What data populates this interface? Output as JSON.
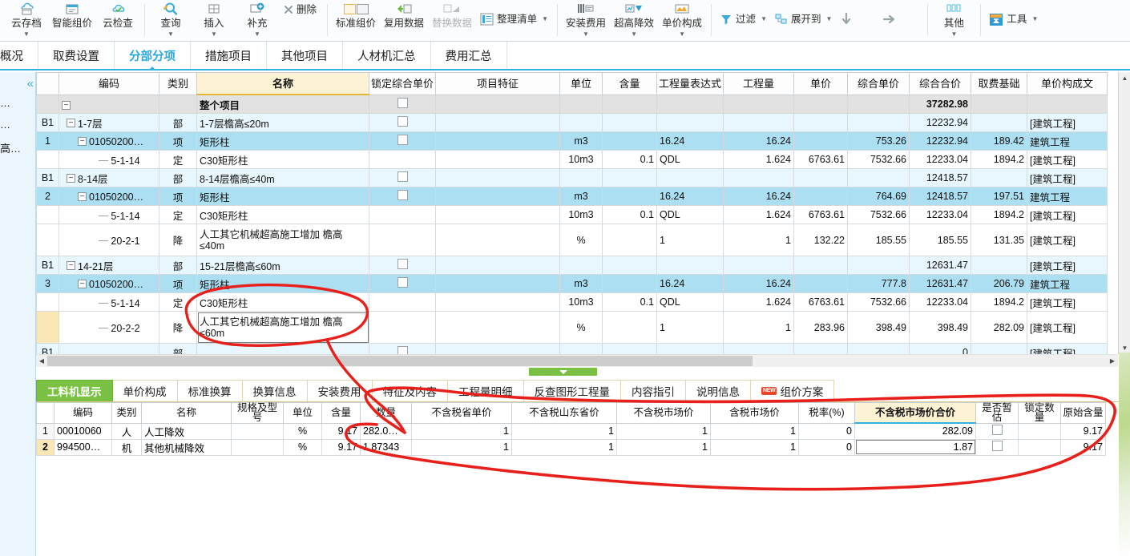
{
  "ribbon": {
    "groups": [
      {
        "name": "cloud",
        "items": [
          {
            "label": "云存档",
            "icon": "cloud-archive-icon",
            "caret": true
          },
          {
            "label": "智能组价",
            "icon": "smart-price-icon",
            "caret": false
          },
          {
            "label": "云检查",
            "icon": "cloud-check-icon",
            "caret": false
          }
        ]
      },
      {
        "name": "edit",
        "items": [
          {
            "label": "查询",
            "icon": "search-icon",
            "caret": true
          },
          {
            "label": "插入",
            "icon": "insert-icon",
            "caret": true
          },
          {
            "label": "补充",
            "icon": "supplement-icon",
            "caret": true
          },
          {
            "label": "删除",
            "icon": "delete-icon",
            "caret": false
          }
        ]
      },
      {
        "name": "data",
        "items": [
          {
            "label": "标准组价",
            "icon": "standard-price-icon",
            "caret": false
          },
          {
            "label": "复用数据",
            "icon": "reuse-data-icon",
            "caret": false
          },
          {
            "label": "替换数据",
            "icon": "replace-data-icon",
            "caret": false,
            "disabled": true
          },
          {
            "label": "整理清单",
            "icon": "organize-list-icon",
            "caret": true
          }
        ]
      },
      {
        "name": "cost",
        "items": [
          {
            "label": "安装费用",
            "icon": "install-cost-icon",
            "caret": true
          },
          {
            "label": "超高降效",
            "icon": "height-efficiency-icon",
            "caret": true
          },
          {
            "label": "单价构成",
            "icon": "unit-price-composition-icon",
            "caret": true
          }
        ]
      },
      {
        "name": "view",
        "items": [
          {
            "label": "过滤",
            "icon": "filter-icon",
            "caret": true
          },
          {
            "label": "展开到",
            "icon": "expand-to-icon",
            "caret": true
          },
          {
            "label": "",
            "icon": "arrow-down-icon",
            "caret": false
          },
          {
            "label": "",
            "icon": "arrow-right-icon",
            "caret": false
          }
        ]
      },
      {
        "name": "other",
        "items": [
          {
            "label": "其他",
            "icon": "other-icon",
            "caret": true
          }
        ]
      },
      {
        "name": "tools",
        "items": [
          {
            "label": "工具",
            "icon": "tools-icon",
            "caret": true
          }
        ]
      }
    ]
  },
  "module_tabs": [
    {
      "label": "概况",
      "active": false
    },
    {
      "label": "取费设置",
      "active": false
    },
    {
      "label": "分部分项",
      "active": true
    },
    {
      "label": "措施项目",
      "active": false
    },
    {
      "label": "其他项目",
      "active": false
    },
    {
      "label": "人材机汇总",
      "active": false
    },
    {
      "label": "费用汇总",
      "active": false
    }
  ],
  "rail": {
    "collapse_icon": "chevron-double-left-icon",
    "items": [
      "…",
      "…",
      "高…"
    ]
  },
  "main_grid": {
    "columns": [
      "",
      "编码",
      "类别",
      "名称",
      "锁定综合单价",
      "项目特征",
      "单位",
      "含量",
      "工程量表达式",
      "工程量",
      "单价",
      "综合单价",
      "综合合价",
      "取费基础",
      "单价构成文"
    ],
    "rows": [
      {
        "style": "total",
        "rowno": "",
        "tree": "box",
        "indent": 0,
        "code": "",
        "cat": "",
        "name": "整个项目",
        "lock": true,
        "feature": "",
        "unit": "",
        "content": "",
        "expr": "",
        "qty": "",
        "price": "",
        "comp_price": "",
        "total": "37282.98",
        "base": "",
        "comp_doc": ""
      },
      {
        "style": "part",
        "rowno": "B1",
        "tree": "box",
        "indent": 1,
        "code": "1-7层",
        "cat": "部",
        "name": "1-7层檐高≤20m",
        "lock": true,
        "feature": "",
        "unit": "",
        "content": "",
        "expr": "",
        "qty": "",
        "price": "",
        "comp_price": "",
        "total": "12232.94",
        "base": "",
        "comp_doc": "[建筑工程]"
      },
      {
        "style": "item",
        "rowno": "1",
        "tree": "box",
        "indent": 2,
        "code": "01050200…",
        "cat": "项",
        "name": "矩形柱",
        "lock": true,
        "feature": "",
        "unit": "m3",
        "content": "",
        "expr": "16.24",
        "qty": "16.24",
        "price": "",
        "comp_price": "753.26",
        "total": "12232.94",
        "base": "189.42",
        "comp_doc": "建筑工程"
      },
      {
        "style": "norm",
        "rowno": "",
        "tree": "leaf",
        "indent": 3,
        "code": "5-1-14",
        "cat": "定",
        "name": "C30矩形柱",
        "lock": false,
        "feature": "",
        "unit": "10m3",
        "content": "0.1",
        "expr": "QDL",
        "qty": "1.624",
        "price": "6763.61",
        "comp_price": "7532.66",
        "total": "12233.04",
        "base": "1894.2",
        "comp_doc": "[建筑工程]"
      },
      {
        "style": "part",
        "rowno": "B1",
        "tree": "box",
        "indent": 1,
        "code": "8-14层",
        "cat": "部",
        "name": "8-14层檐高≤40m",
        "lock": true,
        "feature": "",
        "unit": "",
        "content": "",
        "expr": "",
        "qty": "",
        "price": "",
        "comp_price": "",
        "total": "12418.57",
        "base": "",
        "comp_doc": "[建筑工程]"
      },
      {
        "style": "item",
        "rowno": "2",
        "tree": "box",
        "indent": 2,
        "code": "01050200…",
        "cat": "项",
        "name": "矩形柱",
        "lock": true,
        "feature": "",
        "unit": "m3",
        "content": "",
        "expr": "16.24",
        "qty": "16.24",
        "price": "",
        "comp_price": "764.69",
        "total": "12418.57",
        "base": "197.51",
        "comp_doc": "建筑工程"
      },
      {
        "style": "norm",
        "rowno": "",
        "tree": "leaf",
        "indent": 3,
        "code": "5-1-14",
        "cat": "定",
        "name": "C30矩形柱",
        "lock": false,
        "feature": "",
        "unit": "10m3",
        "content": "0.1",
        "expr": "QDL",
        "qty": "1.624",
        "price": "6763.61",
        "comp_price": "7532.66",
        "total": "12233.04",
        "base": "1894.2",
        "comp_doc": "[建筑工程]"
      },
      {
        "style": "norm",
        "tall": true,
        "rowno": "",
        "tree": "leaf",
        "indent": 3,
        "code": "20-2-1",
        "cat": "降",
        "name": "人工其它机械超高施工增加 檐高≤40m",
        "lock": false,
        "feature": "",
        "unit": "%",
        "content": "",
        "expr": "1",
        "qty": "1",
        "price": "132.22",
        "comp_price": "185.55",
        "total": "185.55",
        "base": "131.35",
        "comp_doc": "[建筑工程]"
      },
      {
        "style": "part",
        "rowno": "B1",
        "tree": "box",
        "indent": 1,
        "code": "14-21层",
        "cat": "部",
        "name": "15-21层檐高≤60m",
        "lock": true,
        "feature": "",
        "unit": "",
        "content": "",
        "expr": "",
        "qty": "",
        "price": "",
        "comp_price": "",
        "total": "12631.47",
        "base": "",
        "comp_doc": "[建筑工程]"
      },
      {
        "style": "item",
        "rowno": "3",
        "tree": "box",
        "indent": 2,
        "code": "01050200…",
        "cat": "项",
        "name": "矩形柱",
        "lock": true,
        "feature": "",
        "unit": "m3",
        "content": "",
        "expr": "16.24",
        "qty": "16.24",
        "price": "",
        "comp_price": "777.8",
        "total": "12631.47",
        "base": "206.79",
        "comp_doc": "建筑工程"
      },
      {
        "style": "norm",
        "rowno": "",
        "tree": "leaf",
        "indent": 3,
        "code": "5-1-14",
        "cat": "定",
        "name": "C30矩形柱",
        "lock": false,
        "feature": "",
        "unit": "10m3",
        "content": "0.1",
        "expr": "QDL",
        "qty": "1.624",
        "price": "6763.61",
        "comp_price": "7532.66",
        "total": "12233.04",
        "base": "1894.2",
        "comp_doc": "[建筑工程]"
      },
      {
        "style": "norm",
        "tall": true,
        "current": true,
        "selected_name": true,
        "rowno": "",
        "tree": "leaf",
        "indent": 3,
        "code": "20-2-2",
        "cat": "降",
        "name": "人工其它机械超高施工增加 檐高≤60m",
        "lock": false,
        "feature": "",
        "unit": "%",
        "content": "",
        "expr": "1",
        "qty": "1",
        "price": "283.96",
        "comp_price": "398.49",
        "total": "398.49",
        "base": "282.09",
        "comp_doc": "[建筑工程]"
      },
      {
        "style": "part",
        "rowno": "B1",
        "tree": "none",
        "indent": 1,
        "code": "",
        "cat": "部",
        "name": "",
        "lock": true,
        "feature": "",
        "unit": "",
        "content": "",
        "expr": "",
        "qty": "",
        "price": "",
        "comp_price": "",
        "total": "0",
        "base": "",
        "comp_doc": "[建筑工程]"
      }
    ]
  },
  "bottom_tabs": [
    {
      "label": "工料机显示",
      "active": true,
      "badge": ""
    },
    {
      "label": "单价构成",
      "active": false,
      "badge": ""
    },
    {
      "label": "标准换算",
      "active": false,
      "badge": ""
    },
    {
      "label": "换算信息",
      "active": false,
      "badge": ""
    },
    {
      "label": "安装费用",
      "active": false,
      "badge": ""
    },
    {
      "label": "特征及内容",
      "active": false,
      "badge": ""
    },
    {
      "label": "工程量明细",
      "active": false,
      "badge": ""
    },
    {
      "label": "反查图形工程量",
      "active": false,
      "badge": ""
    },
    {
      "label": "内容指引",
      "active": false,
      "badge": ""
    },
    {
      "label": "说明信息",
      "active": false,
      "badge": ""
    },
    {
      "label": "组价方案",
      "active": false,
      "badge": "NEW"
    }
  ],
  "bottom_grid": {
    "columns": [
      "",
      "编码",
      "类别",
      "名称",
      "规格及型号",
      "单位",
      "含量",
      "数量",
      "不含税省单价",
      "不含税山东省价",
      "不含税市场价",
      "含税市场价",
      "税率(%)",
      "不含税市场价合价",
      "是否暂估",
      "锁定数量",
      "原始含量"
    ],
    "highlight_column": "不含税市场价合价",
    "rows": [
      {
        "idx": "1",
        "current": false,
        "code": "00010060",
        "cat": "人",
        "name": "人工降效",
        "spec": "",
        "unit": "%",
        "content": "9.17",
        "qty": "282.0…",
        "p_prov": "1",
        "p_sd": "1",
        "p_mkt": "1",
        "p_tax": "1",
        "rate": "0",
        "total": "282.09",
        "est": false,
        "locked": false,
        "orig": "9.17"
      },
      {
        "idx": "2",
        "current": true,
        "code": "994500…",
        "cat": "机",
        "name": "其他机械降效",
        "spec": "",
        "unit": "%",
        "content": "9.17",
        "qty": "1.87343",
        "p_prov": "1",
        "p_sd": "1",
        "p_mkt": "1",
        "p_tax": "1",
        "rate": "0",
        "total": "1.87",
        "est": false,
        "locked": false,
        "orig": "9.17"
      }
    ]
  },
  "annotation": {
    "color": "#e8201b",
    "shapes": [
      "ellipse-around-row-20-2-2",
      "large-loop-bottom-table"
    ]
  }
}
